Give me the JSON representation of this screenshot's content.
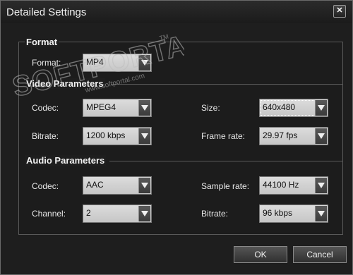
{
  "window": {
    "title": "Detailed Settings",
    "close_symbol": "✕"
  },
  "watermark": {
    "brand_text": "SOFTPORTAL",
    "tm": "TM",
    "url": "www.softportal.com"
  },
  "format": {
    "section_label": "Format",
    "format_label": "Format:",
    "format_value": "MP4"
  },
  "video": {
    "section_label": "Video Parameters",
    "codec_label": "Codec:",
    "codec_value": "MPEG4",
    "size_label": "Size:",
    "size_value": "640x480",
    "bitrate_label": "Bitrate:",
    "bitrate_value": "1200 kbps",
    "framerate_label": "Frame rate:",
    "framerate_value": "29.97 fps"
  },
  "audio": {
    "section_label": "Audio Parameters",
    "codec_label": "Codec:",
    "codec_value": "AAC",
    "samplerate_label": "Sample rate:",
    "samplerate_value": "44100 Hz",
    "channel_label": "Channel:",
    "channel_value": "2",
    "bitrate_label": "Bitrate:",
    "bitrate_value": "96 kbps"
  },
  "buttons": {
    "ok": "OK",
    "cancel": "Cancel"
  }
}
